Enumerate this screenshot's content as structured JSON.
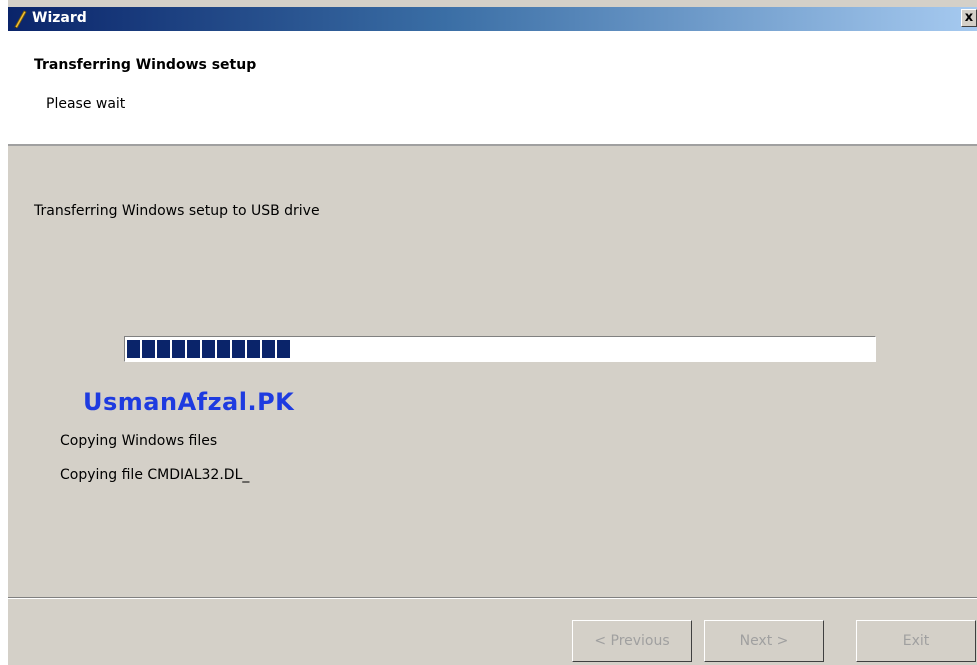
{
  "window": {
    "title": "Wizard",
    "close_label": "x"
  },
  "header": {
    "title": "Transferring Windows setup",
    "subtitle": "Please wait"
  },
  "body": {
    "status": "Transferring Windows setup to USB drive",
    "progress_fraction": 0.22,
    "watermark": "UsmanAfzal.PK",
    "step": "Copying Windows files",
    "file": "Copying file CMDIAL32.DL_"
  },
  "footer": {
    "previous_label": "< Previous",
    "next_label": "Next >",
    "exit_label": "Exit"
  },
  "colors": {
    "titlebar_start": "#0a246a",
    "progress_fill": "#0a246a",
    "watermark": "#1e3be0",
    "face": "#d4d0c8"
  }
}
